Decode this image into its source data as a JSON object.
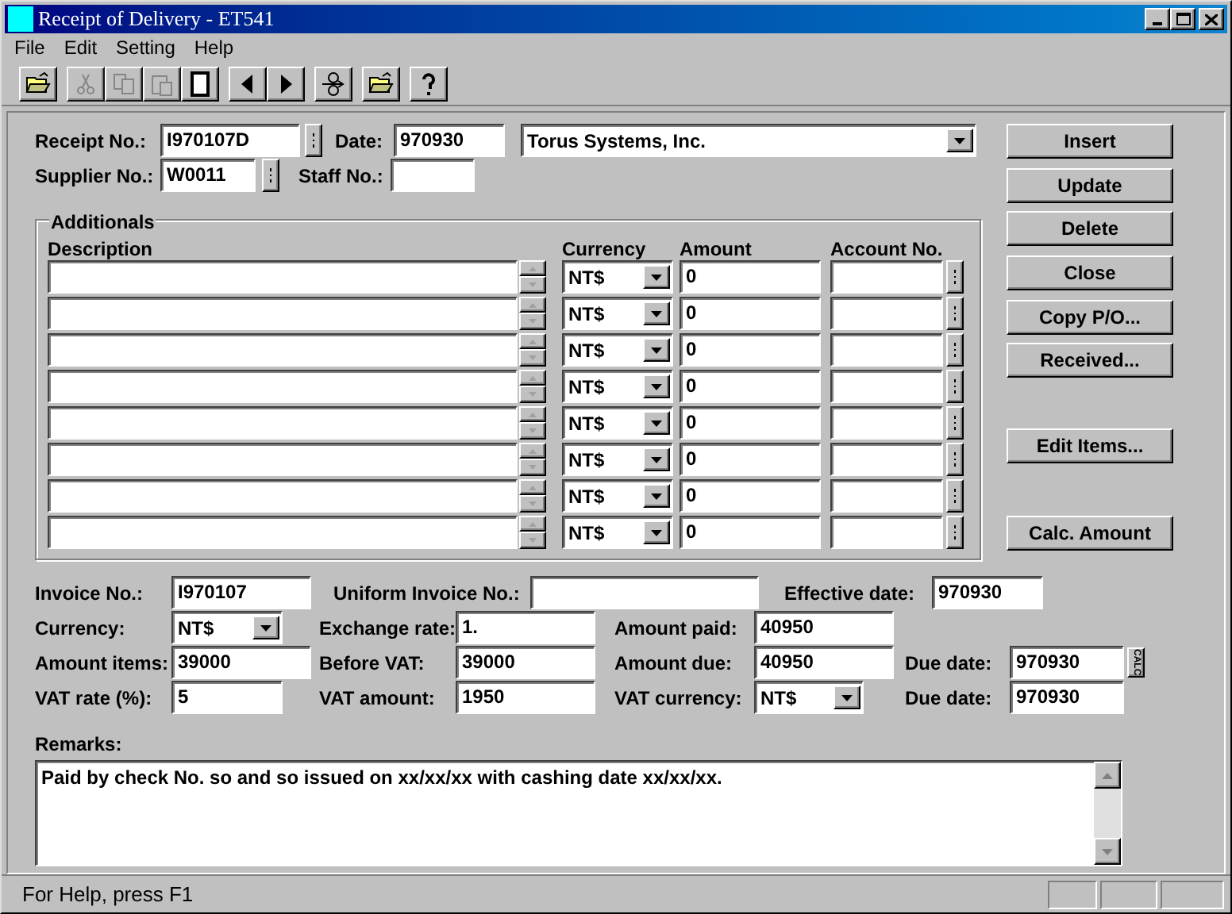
{
  "window": {
    "title": "Receipt of Delivery - ET541"
  },
  "menu": [
    "File",
    "Edit",
    "Setting",
    "Help"
  ],
  "toolbar": [
    [
      {
        "kind": "open",
        "disabled": false
      }
    ],
    [
      {
        "kind": "cut",
        "disabled": true
      },
      {
        "kind": "copy",
        "disabled": true
      },
      {
        "kind": "paste",
        "disabled": true
      },
      {
        "kind": "new",
        "disabled": false
      }
    ],
    [
      {
        "kind": "prev",
        "disabled": false
      },
      {
        "kind": "next",
        "disabled": false
      }
    ],
    [
      {
        "kind": "link",
        "disabled": false
      }
    ],
    [
      {
        "kind": "open",
        "disabled": false
      }
    ],
    [
      {
        "kind": "help",
        "disabled": false
      }
    ]
  ],
  "header": {
    "receipt_no": {
      "label": "Receipt No.:",
      "value": "I970107D"
    },
    "date": {
      "label": "Date:",
      "value": "970930"
    },
    "supplier": {
      "value": "Torus Systems, Inc."
    },
    "supplier_no": {
      "label": "Supplier No.:",
      "value": "W0011"
    },
    "staff_no": {
      "label": "Staff No.:"
    }
  },
  "additionals": {
    "title": "Additionals",
    "columns": [
      "Description",
      "Currency",
      "Amount",
      "Account No."
    ],
    "rows": [
      {
        "currency": "NT$",
        "amount": "0"
      },
      {
        "currency": "NT$",
        "amount": "0"
      },
      {
        "currency": "NT$",
        "amount": "0"
      },
      {
        "currency": "NT$",
        "amount": "0"
      },
      {
        "currency": "NT$",
        "amount": "0"
      },
      {
        "currency": "NT$",
        "amount": "0"
      },
      {
        "currency": "NT$",
        "amount": "0"
      },
      {
        "currency": "NT$",
        "amount": "0"
      }
    ]
  },
  "buttons": [
    "Insert",
    "Update",
    "Delete",
    "Close",
    "Copy P/O...",
    "Received...",
    "Edit Items...",
    "Calc. Amount"
  ],
  "invoice": {
    "invoice_no": {
      "label": "Invoice No.:",
      "value": "I970107"
    },
    "uniform_invoice_no": {
      "label": "Uniform Invoice No.:"
    },
    "effective_date": {
      "label": "Effective date:",
      "value": "970930"
    },
    "currency": {
      "label": "Currency:",
      "value": "NT$"
    },
    "exchange_rate": {
      "label": "Exchange rate:",
      "value": "1."
    },
    "amount_paid": {
      "label": "Amount paid:",
      "value": "40950"
    },
    "amount_items": {
      "label": "Amount items:",
      "value": "39000"
    },
    "before_vat": {
      "label": "Before VAT:",
      "value": "39000"
    },
    "amount_due": {
      "label": "Amount due:",
      "value": "40950"
    },
    "due_date": {
      "label": "Due date:",
      "value": "970930"
    },
    "calc_button": "CALC",
    "vat_rate": {
      "label": "VAT rate (%):",
      "value": "5"
    },
    "vat_amount": {
      "label": "VAT amount:",
      "value": "1950"
    },
    "vat_currency": {
      "label": "VAT currency:",
      "value": "NT$"
    },
    "due_date_2": {
      "label": "Due date:",
      "value": "970930"
    }
  },
  "remarks": {
    "label": "Remarks:",
    "value": "Paid by check No. so and so issued on xx/xx/xx with cashing date xx/xx/xx."
  },
  "status_bar": {
    "text": "For Help, press F1"
  }
}
